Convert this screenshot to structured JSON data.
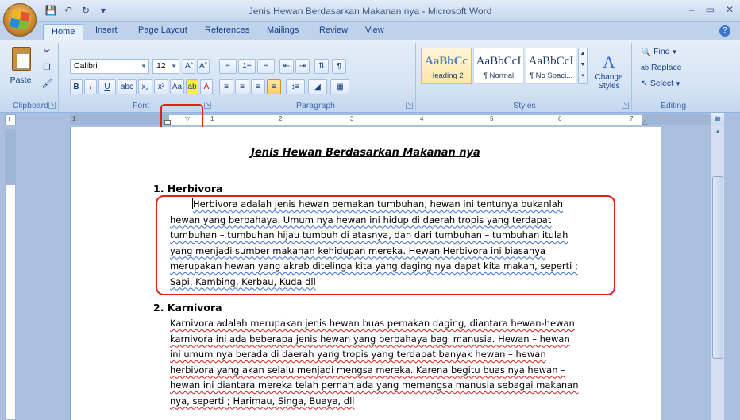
{
  "window": {
    "title": "Jenis Hewan Berdasarkan Makanan nya - Microsoft Word"
  },
  "tabs": [
    "Home",
    "Insert",
    "Page Layout",
    "References",
    "Mailings",
    "Review",
    "View"
  ],
  "ribbon": {
    "clipboard": {
      "label": "Clipboard",
      "paste": "Paste"
    },
    "font": {
      "label": "Font",
      "name": "Calibri",
      "size": "12"
    },
    "paragraph": {
      "label": "Paragraph"
    },
    "styles": {
      "label": "Styles",
      "items": [
        {
          "preview": "AaBbCc",
          "name": "Heading 2"
        },
        {
          "preview": "AaBbCcI",
          "name": "¶ Normal"
        },
        {
          "preview": "AaBbCcI",
          "name": "¶ No Spaci..."
        }
      ],
      "change": "Change Styles"
    },
    "editing": {
      "label": "Editing",
      "find": "Find",
      "replace": "Replace",
      "select": "Select"
    }
  },
  "ruler": {
    "numbers": [
      "1",
      "1",
      "2",
      "3",
      "4",
      "5",
      "6",
      "7"
    ]
  },
  "document": {
    "title": "Jenis Hewan Berdasarkan Makanan nya",
    "sections": [
      {
        "heading": "1.  Herbivora",
        "lines": [
          "Herbivora adalah jenis hewan pemakan tumbuhan, hewan ini tentunya bukanlah",
          "hewan yang berbahaya. Umum nya hewan ini hidup di daerah tropis yang terdapat",
          "tumbuhan – tumbuhan hijau tumbuh di atasnya, dan dari tumbuhan – tumbuhan itulah",
          "yang menjadi sumber makanan kehidupan mereka. Hewan Herbivora ini biasanya",
          "merupakan hewan yang akrab ditelinga kita yang daging nya dapat kita makan, seperti ;",
          "Sapi, Kambing, Kerbau, Kuda dll"
        ]
      },
      {
        "heading": "2.  Karnivora",
        "lines": [
          "Karnivora adalah merupakan jenis hewan buas pemakan daging, diantara hewan-hewan",
          "karnivora ini ada beberapa jenis hewan yang berbahaya bagi manusia. Hewan – hewan",
          "ini umum nya berada di daerah yang tropis yang terdapat banyak hewan – hewan",
          "herbivora yang akan selalu menjadi mengsa mereka. Karena begitu buas nya hewan –",
          "hewan ini diantara mereka telah pernah ada yang memangsa manusia sebagai makanan",
          "nya, seperti ; Harimau, Singa, Buaya, dll"
        ]
      }
    ]
  },
  "colors": {
    "highlight": "#e0201a",
    "ribbon_bg": "#d3e2f4",
    "spell_underline": "#3c6ed0"
  }
}
